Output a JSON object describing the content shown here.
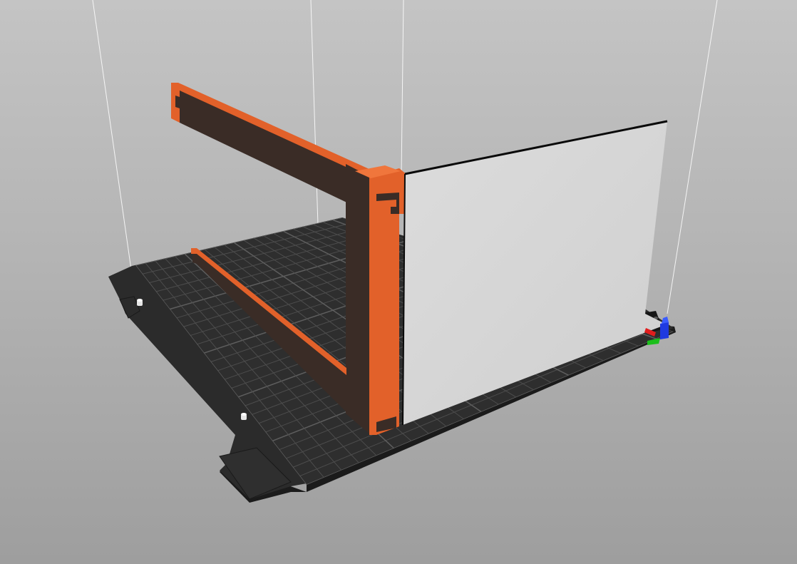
{
  "app": {
    "view": "3d-print-preparation-viewport"
  },
  "colors": {
    "background_top": "#c4c4c4",
    "background_bottom": "#9e9e9e",
    "bed_surface": "#2a2a2a",
    "bed_edge": "#1b1b1b",
    "grid_line": "#4a4a4a",
    "model_dark": "#3a2c26",
    "model_accent": "#e2612a",
    "panel_face": "#d7d7d7",
    "panel_edge": "#0a0a0a",
    "camera_line": "#ffffff",
    "axis_x": "#e11d1d",
    "axis_y": "#1bbf1b",
    "axis_z": "#1f3ae0"
  },
  "icons": {
    "axis_gizmo": "xyz-axes-icon",
    "bed_peg": "bed-peg-icon"
  },
  "objects": [
    {
      "name": "orange-frame-part"
    },
    {
      "name": "white-panel-part"
    }
  ]
}
